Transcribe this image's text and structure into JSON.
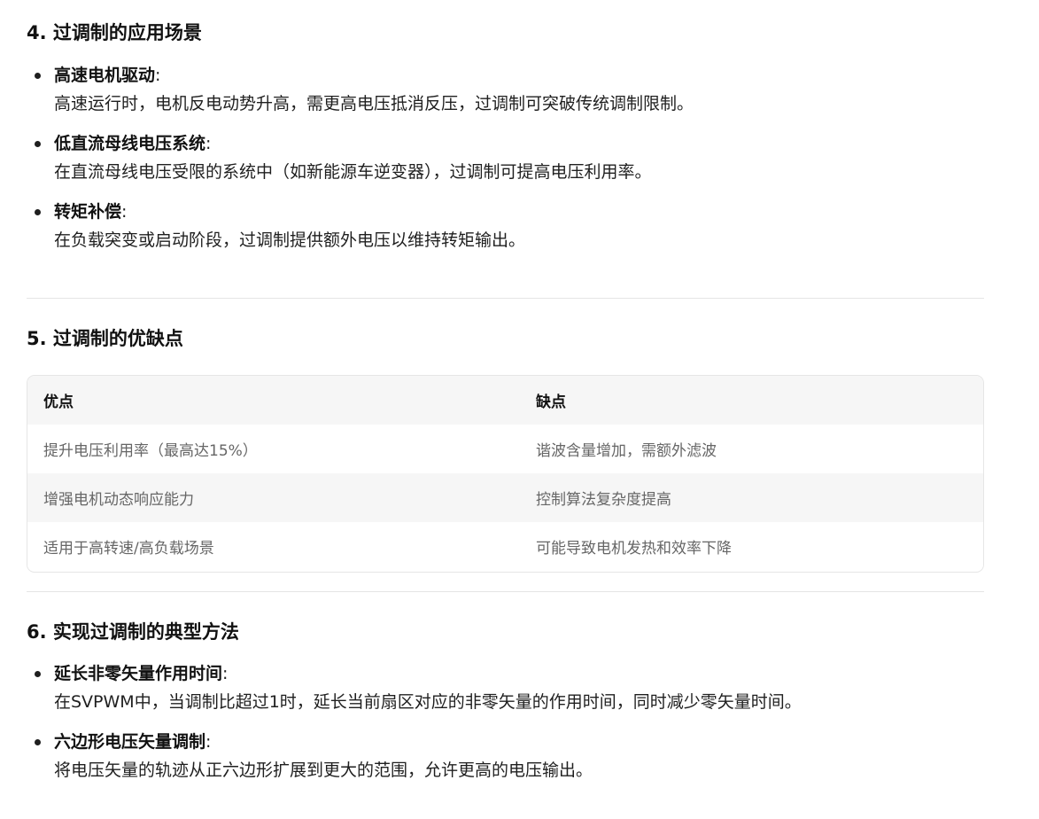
{
  "sections": {
    "s4": {
      "heading": "4. 过调制的应用场景",
      "items": [
        {
          "title": "高速电机驱动",
          "colon": ":",
          "desc": "高速运行时，电机反电动势升高，需更高电压抵消反压，过调制可突破传统调制限制。"
        },
        {
          "title": "低直流母线电压系统",
          "colon": ":",
          "desc": "在直流母线电压受限的系统中（如新能源车逆变器），过调制可提高电压利用率。"
        },
        {
          "title": "转矩补偿",
          "colon": ":",
          "desc": "在负载突变或启动阶段，过调制提供额外电压以维持转矩输出。"
        }
      ]
    },
    "s5": {
      "heading": "5. 过调制的优缺点",
      "table": {
        "headers": [
          "优点",
          "缺点"
        ],
        "rows": [
          [
            "提升电压利用率（最高达15%）",
            "谐波含量增加，需额外滤波"
          ],
          [
            "增强电机动态响应能力",
            "控制算法复杂度提高"
          ],
          [
            "适用于高转速/高负载场景",
            "可能导致电机发热和效率下降"
          ]
        ]
      }
    },
    "s6": {
      "heading": "6. 实现过调制的典型方法",
      "items": [
        {
          "title": "延长非零矢量作用时间",
          "colon": ":",
          "desc": "在SVPWM中，当调制比超过1时，延长当前扇区对应的非零矢量的作用时间，同时减少零矢量时间。"
        },
        {
          "title": "六边形电压矢量调制",
          "colon": ":",
          "desc": "将电压矢量的轨迹从正六边形扩展到更大的范围，允许更高的电压输出。"
        }
      ]
    }
  }
}
